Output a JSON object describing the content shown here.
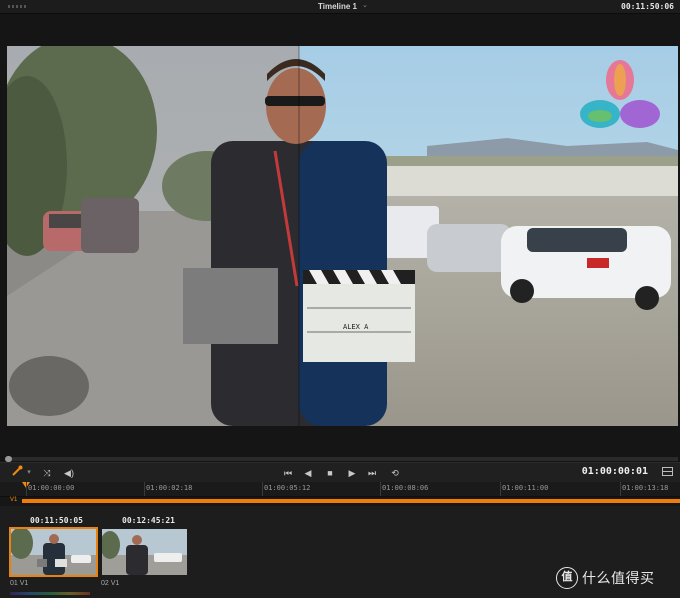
{
  "topbar": {
    "timeline_name": "Timeline 1",
    "timeline_caret": "⌄",
    "source_timecode": "00:11:50:06"
  },
  "viewer": {
    "logo": "davinci-resolve-logo",
    "slate_lines": [
      "ALEX A"
    ]
  },
  "transport": {
    "icons": [
      "eyedropper-icon",
      "shuffle-icon",
      "volume-icon",
      "skip-back-icon",
      "play-reverse-icon",
      "stop-icon",
      "play-icon",
      "skip-forward-icon",
      "loop-icon",
      "grid-view-icon"
    ],
    "current_timecode": "01:00:00:01"
  },
  "ruler": {
    "ticks": [
      "01:00:00:00",
      "01:00:02:18",
      "01:00:05:12",
      "01:00:08:06",
      "01:00:11:00",
      "01:00:13:18"
    ]
  },
  "track": {
    "label": "V1"
  },
  "clips": [
    {
      "timecode": "00:11:50:05",
      "label": "01  V1",
      "selected": true
    },
    {
      "timecode": "00:12:45:21",
      "label": "02  V1",
      "selected": false
    }
  ],
  "watermark": {
    "symbol": "值",
    "text": "什么值得买"
  },
  "colors": {
    "accent": "#f07d0a",
    "background": "#141414"
  }
}
